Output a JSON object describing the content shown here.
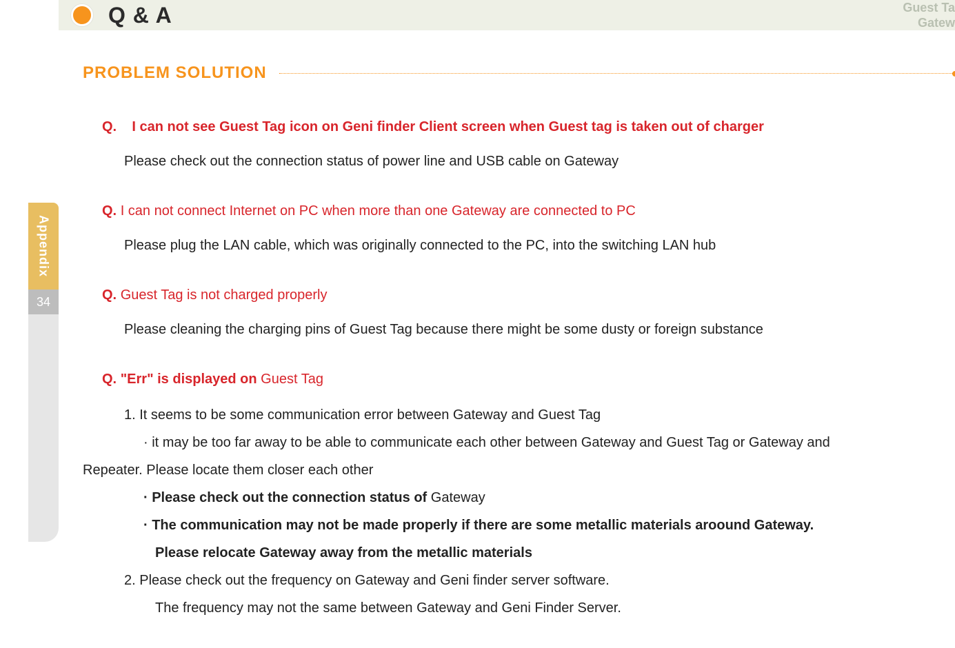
{
  "header": {
    "title": "Q & A",
    "top_right_line1": "Guest Ta",
    "top_right_line2": "Gatew"
  },
  "sidebar": {
    "tab_label": "Appendix",
    "page_number": "34"
  },
  "section": {
    "title": "PROBLEM SOLUTION"
  },
  "qa": [
    {
      "q_prefix": "Q.",
      "q_text": "I can not see Guest Tag icon on Geni finder Client screen when Guest tag is taken out of charger",
      "q_bold": true,
      "answer": "Please check out the connection status of power line and USB cable on Gateway"
    },
    {
      "q_prefix": "Q.",
      "q_text": "I can not connect Internet on PC when more than one Gateway are connected to PC",
      "q_bold": false,
      "answer": "Please plug the LAN cable, which was originally connected to the PC, into the switching LAN hub"
    },
    {
      "q_prefix": "Q.",
      "q_text": "Guest Tag is not charged properly",
      "q_bold": false,
      "answer": "Please cleaning the charging pins of Guest Tag because there might be some dusty or foreign substance"
    }
  ],
  "err": {
    "q_prefix": "Q.",
    "q_bold_part": "\"Err\" is displayed on",
    "q_rest": "Guest Tag",
    "lines": [
      {
        "cls": "indent1",
        "text": "1. It seems to be some communication error between Gateway and Guest Tag",
        "bold": false
      },
      {
        "cls": "indent2",
        "text": "· it may be too far away to be able to communicate each other between Gateway and Guest Tag or Gateway and",
        "bold": false
      },
      {
        "cls": "no-indent",
        "text": "Repeater.  Please locate them closer each other",
        "bold": false
      },
      {
        "cls": "indent2",
        "text_bold": "· Please check out the connection status of ",
        "text_rest": "Gateway",
        "mixed": true
      },
      {
        "cls": "indent2",
        "text": "· The communication may not be made properly if there are some metallic materials aroound Gateway.",
        "bold": true
      },
      {
        "cls": "indent3",
        "text": "Please relocate Gateway away from the metallic materials",
        "bold": true
      },
      {
        "cls": "indent1",
        "text": "2. Please check out the frequency on Gateway and Geni finder server software.",
        "bold": false
      },
      {
        "cls": "indent3",
        "text": "The frequency may not the same between Gateway and Geni Finder Server.",
        "bold": false
      }
    ]
  }
}
